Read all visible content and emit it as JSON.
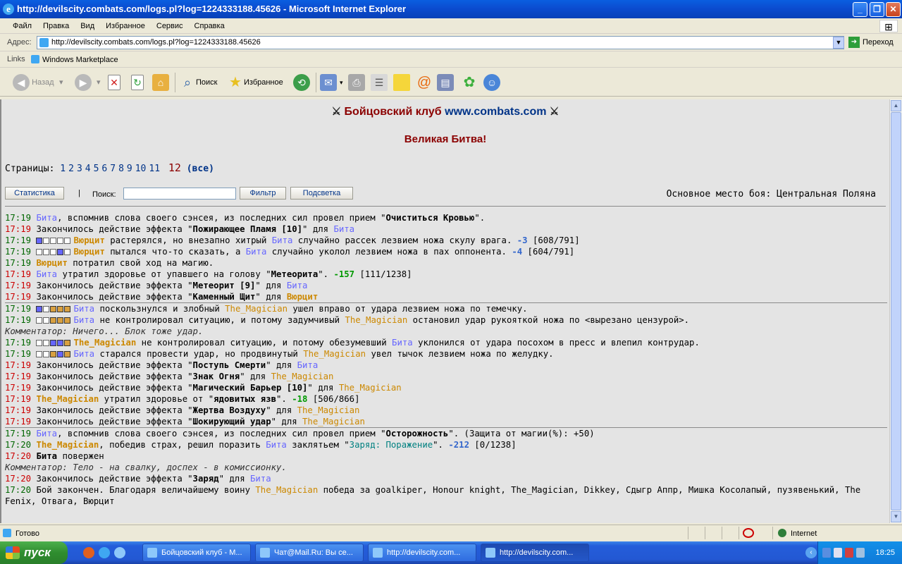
{
  "window": {
    "title": "http://devilscity.combats.com/logs.pl?log=1224333188.45626 - Microsoft Internet Explorer"
  },
  "menu": [
    "Файл",
    "Правка",
    "Вид",
    "Избранное",
    "Сервис",
    "Справка"
  ],
  "address": {
    "label": "Адрес:",
    "url": "http://devilscity.combats.com/logs.pl?log=1224333188.45626",
    "go": "Переход"
  },
  "links": {
    "label": "Links",
    "item": "Windows Marketplace"
  },
  "toolbar": {
    "back": "Назад",
    "search": "Поиск",
    "favorites": "Избранное"
  },
  "page": {
    "title_text": "Бойцовский клуб",
    "title_link": "www.combats.com",
    "subtitle": "Великая Битва!",
    "pages_label": "Страницы:",
    "pages": [
      "1",
      "2",
      "3",
      "4",
      "5",
      "6",
      "7",
      "8",
      "9",
      "10",
      "11"
    ],
    "current_page": "12",
    "all_pages": "(все)",
    "stats_button": "Статистика",
    "separator": "|",
    "search_label": "Поиск:",
    "filter_button": "Фильтр",
    "highlight_button": "Подсветка",
    "place": "Основное место боя: Центральная Поляна"
  },
  "log": {
    "l1": [
      "17:19",
      "Бита",
      ", вспомнив слова своего сэнсея, из последних сил провел прием \"",
      "Очиститься Кровью",
      "\"."
    ],
    "l2": [
      "17:19",
      "Закончилось действие эффекта \"",
      "Пожирающее Пламя [10]",
      "\" для ",
      "Бита"
    ],
    "l3": [
      "17:19",
      "Вюрцит",
      " растерялся, но внезапно хитрый ",
      "Бита",
      " случайно рассек лезвием ножа скулу врага. ",
      "-3",
      " [608/791]"
    ],
    "l4": [
      "17:19",
      "Вюрцит",
      " пытался что-то сказать, а ",
      "Бита",
      " случайно уколол лезвием ножа в пах оппонента. ",
      "-4",
      " [604/791]"
    ],
    "l5": [
      "17:19",
      "Вюрцит",
      " потратил свой ход на магию."
    ],
    "l6": [
      "17:19",
      "Бита",
      " утратил здоровье от упавшего на голову \"",
      "Метеорита",
      "\". ",
      "-157",
      " [111/1238]"
    ],
    "l7": [
      "17:19",
      "Закончилось действие эффекта \"",
      "Метеорит [9]",
      "\" для ",
      "Бита"
    ],
    "l8": [
      "17:19",
      "Закончилось действие эффекта \"",
      "Каменный Щит",
      "\" для ",
      "Вюрцит"
    ],
    "l9": [
      "17:19",
      "Бита",
      " поскользнулся и злобный ",
      "The_Magician",
      " ушел вправо от удара лезвием ножа по темечку."
    ],
    "l10": [
      "17:19",
      "Бита",
      " не контролировал ситуацию, и потому задумчивый ",
      "The_Magician",
      " остановил удар рукояткой ножа по <вырезано цензурой>."
    ],
    "c1": "Комментатор: Ничего... Блок тоже удар.",
    "l11": [
      "17:19",
      "The_Magician",
      " не контролировал ситуацию, и потому обезумевший ",
      "Бита",
      " уклонился от удара посохом в пресс и влепил контрудар."
    ],
    "l12": [
      "17:19",
      "Бита",
      " старался провести удар, но продвинутый ",
      "The_Magician",
      " увел тычок лезвием ножа по желудку."
    ],
    "l13": [
      "17:19",
      "Закончилось действие эффекта \"",
      "Поступь Смерти",
      "\" для ",
      "Бита"
    ],
    "l14": [
      "17:19",
      "Закончилось действие эффекта \"",
      "Знак Огня",
      "\" для ",
      "The_Magician"
    ],
    "l15": [
      "17:19",
      "Закончилось действие эффекта \"",
      "Магический Барьер [10]",
      "\" для ",
      "The_Magician"
    ],
    "l16": [
      "17:19",
      "The_Magician",
      " утратил здоровье от \"",
      "ядовитых язв",
      "\". ",
      "-18",
      " [506/866]"
    ],
    "l17": [
      "17:19",
      "Закончилось действие эффекта \"",
      "Жертва Воздуху",
      "\" для ",
      "The_Magician"
    ],
    "l18": [
      "17:19",
      "Закончилось действие эффекта \"",
      "Шокирующий удар",
      "\" для ",
      "The_Magician"
    ],
    "l19": [
      "17:19",
      "Бита",
      ", вспомнив слова своего сэнсея, из последних сил провел прием \"",
      "Осторожность",
      "\". (Защита от магии(%): +50)"
    ],
    "l20": [
      "17:20",
      "The_Magician",
      ", победив страх, решил поразить ",
      "Бита",
      " заклятьем \"",
      "Заряд: Поражение",
      "\". ",
      "-212",
      " [0/1238]"
    ],
    "l21": [
      "17:20",
      "Бита",
      " повержен"
    ],
    "c2": "Комментатор: Тело - на свалку, доспех - в комиссионку.",
    "l22": [
      "17:20",
      "Закончилось действие эффекта \"",
      "Заряд",
      "\" для ",
      "Бита"
    ],
    "l23": [
      "17:20",
      "Бой закончен. Благодаря величайшему воину ",
      "The_Magician",
      " победа за goalkiper, Honour knight, The_Magician, Dikkey, Сдыгр Аппр, Мишка Косолапый, пузявенький, The Fenix, Отвага, Вюрцит"
    ]
  },
  "status": {
    "text": "Готово",
    "zone": "Internet"
  },
  "taskbar": {
    "start": "пуск",
    "tasks": [
      "Бойцовский клуб - М...",
      "Чат@Mail.Ru: Вы се...",
      "http://devilscity.com...",
      "http://devilscity.com..."
    ],
    "clock": "18:25"
  },
  "colors": {
    "title_bar": "#0A5FE0",
    "player_blue": "#6666FF",
    "player_orange": "#CC8800",
    "time_green": "#006600",
    "time_red": "#CC0000",
    "header_red": "#8B0000"
  }
}
